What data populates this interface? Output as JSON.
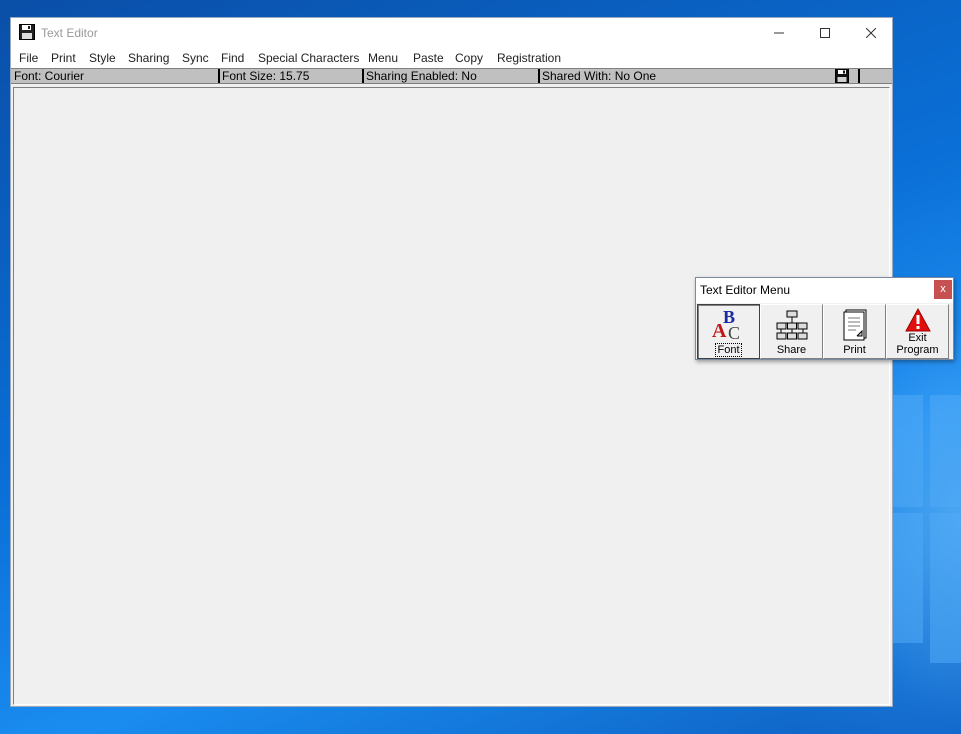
{
  "window": {
    "title": "Text Editor",
    "controls": {
      "minimize": "—",
      "maximize": "☐",
      "close": "✕"
    }
  },
  "menubar": {
    "items": [
      "File",
      "Print",
      "Style",
      "Sharing",
      "Sync",
      "Find",
      "Special Characters",
      "Menu",
      "Paste",
      "Copy",
      "Registration"
    ]
  },
  "statusbar": {
    "font": "Font:  Courier",
    "font_size": "Font Size: 15.75",
    "sharing_enabled": "Sharing Enabled:  No",
    "shared_with": "Shared With:   No One"
  },
  "editor": {
    "content": ""
  },
  "floating_menu": {
    "title": "Text Editor Menu",
    "close_label": "x",
    "buttons": [
      {
        "label": "Font",
        "icon": "font-abc-icon"
      },
      {
        "label": "Share",
        "icon": "share-network-icon"
      },
      {
        "label": "Print",
        "icon": "print-page-icon"
      },
      {
        "label_line1": "Exit",
        "label_line2": "Program",
        "icon": "warning-exit-icon"
      }
    ]
  },
  "colors": {
    "warning_red": "#e01010",
    "close_red": "#c75050",
    "font_icon_blue": "#1a2aa0",
    "font_icon_red": "#c01818"
  }
}
